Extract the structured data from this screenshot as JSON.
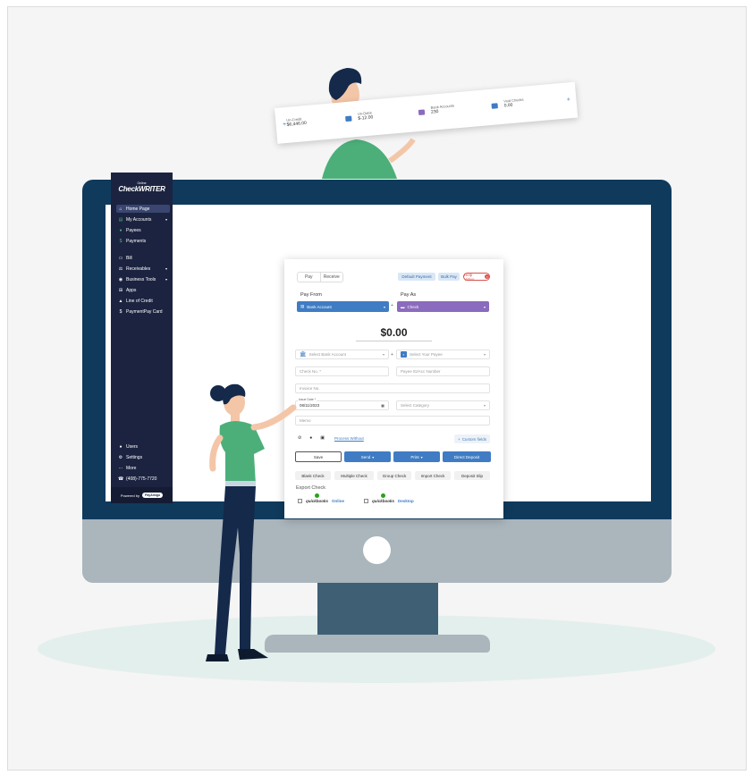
{
  "colors": {
    "monitor_frame": "#0f3a5c",
    "sidebar_bg": "#1b2340",
    "primary": "#3f7cc4",
    "check_purple": "#8a6bbd",
    "accent_green": "#4caf7a"
  },
  "summary_bar": {
    "stats": [
      {
        "label": "Un-Credit",
        "value": "$6,446.00",
        "icon": "wallet-icon"
      },
      {
        "label": "Un-Debit",
        "value": "$-12.00",
        "icon": "card-icon"
      },
      {
        "label": "Bank Accounts",
        "value": "230",
        "icon": "bank-icon"
      },
      {
        "label": "Void Checks",
        "value": "0.00",
        "icon": "building-icon"
      }
    ]
  },
  "sidebar": {
    "logo": "CheckWRITER",
    "logo_sub": "Online",
    "items": [
      {
        "label": "Home Page",
        "icon": "home-icon",
        "active": true
      },
      {
        "label": "My Accounts",
        "icon": "accounts-icon",
        "has_submenu": true
      },
      {
        "label": "Payees",
        "icon": "payees-icon"
      },
      {
        "label": "Payments",
        "icon": "dollar-icon"
      },
      {
        "label": "Bill",
        "icon": "bill-icon"
      },
      {
        "label": "Receivables",
        "icon": "receivables-icon",
        "has_submenu": true
      },
      {
        "label": "Business Tools",
        "icon": "tools-icon",
        "has_submenu": true
      },
      {
        "label": "Apps",
        "icon": "apps-icon"
      },
      {
        "label": "Line of Credit",
        "icon": "credit-icon"
      },
      {
        "label": "PaymentPay Card",
        "icon": "card-icon"
      }
    ],
    "bottom_items": [
      {
        "label": "Users",
        "icon": "user-icon"
      },
      {
        "label": "Settings",
        "icon": "gear-icon"
      },
      {
        "label": "More",
        "icon": "more-icon"
      },
      {
        "label": "(408)-775-7720",
        "icon": "phone-icon"
      }
    ],
    "powered_by": "Powered by",
    "powered_brand": "PayAmigo"
  },
  "check_form": {
    "mode_tabs": [
      "Pay",
      "Receive"
    ],
    "top_buttons": {
      "default_payment": "Default Payment",
      "bulk_pay": "Bulk Pay",
      "help": "Help Video"
    },
    "pay_from_label": "Pay From",
    "pay_as_label": "Pay As",
    "pay_from_value": "Bank Account",
    "pay_as_value": "Check",
    "amount": "$0.00",
    "bank_placeholder": "Select Bank Account",
    "payee_placeholder": "Select Your Payee",
    "check_no_placeholder": "Check No. *",
    "payee_id_placeholder": "Payee ID/Acc Number",
    "invoice_placeholder": "Invoice No.",
    "issue_date_label": "Issue Date *",
    "issue_date_value": "08/11/2023",
    "category_placeholder": "Select Category",
    "memo_placeholder": "Memo",
    "process_link": "Process Without",
    "custom_fields": "Custom fields",
    "actions": {
      "save": "Save",
      "send": "Send",
      "print": "Print",
      "direct_deposit": "Direct Deposit"
    },
    "tabs": [
      "Blank Check",
      "Multiple Check",
      "Group Check",
      "Import Check",
      "Deposit Slip"
    ],
    "export_title": "Export Check",
    "export_options": [
      {
        "logo": "quickbooks",
        "kind": "Online"
      },
      {
        "logo": "quickbooks",
        "kind": "Desktop"
      }
    ]
  }
}
